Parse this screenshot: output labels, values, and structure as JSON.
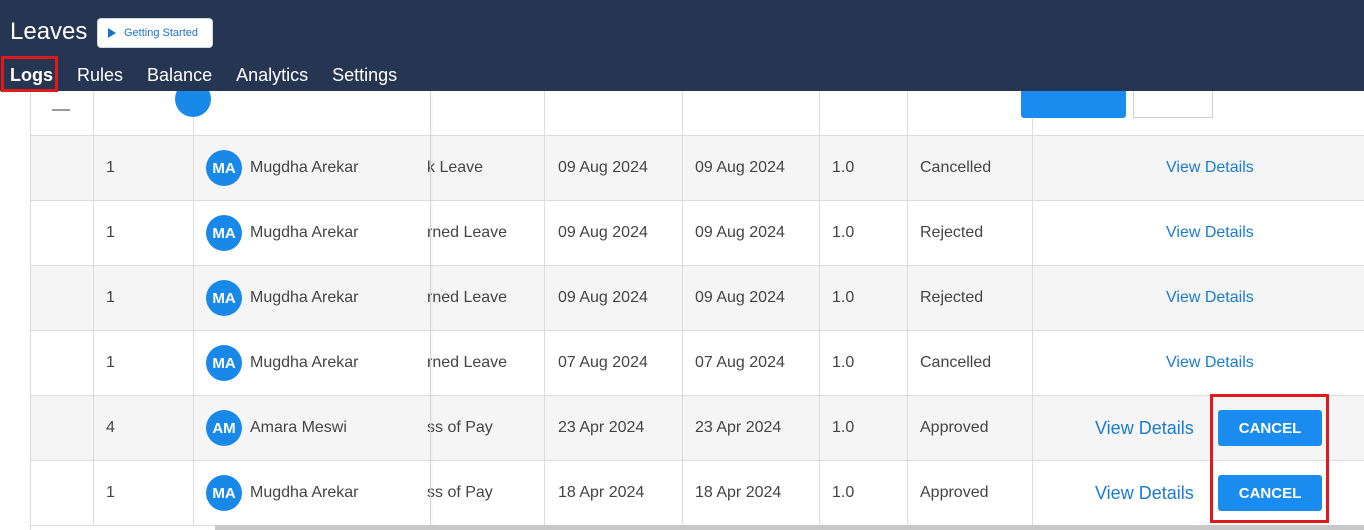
{
  "app": {
    "title": "Leaves",
    "getting_started_label": "Getting Started"
  },
  "tabs": [
    {
      "label": "Logs",
      "active": true
    },
    {
      "label": "Rules",
      "active": false
    },
    {
      "label": "Balance",
      "active": false
    },
    {
      "label": "Analytics",
      "active": false
    },
    {
      "label": "Settings",
      "active": false
    }
  ],
  "rows": [
    {
      "count": "1",
      "initials": "MA",
      "name": "Mugdha Arekar",
      "leave_type": "k Leave",
      "from": "09 Aug 2024",
      "to": "09 Aug 2024",
      "days": "1.0",
      "status": "Cancelled",
      "view": "View Details",
      "cancel": ""
    },
    {
      "count": "1",
      "initials": "MA",
      "name": "Mugdha Arekar",
      "leave_type": "rned Leave",
      "from": "09 Aug 2024",
      "to": "09 Aug 2024",
      "days": "1.0",
      "status": "Rejected",
      "view": "View Details",
      "cancel": ""
    },
    {
      "count": "1",
      "initials": "MA",
      "name": "Mugdha Arekar",
      "leave_type": "rned Leave",
      "from": "09 Aug 2024",
      "to": "09 Aug 2024",
      "days": "1.0",
      "status": "Rejected",
      "view": "View Details",
      "cancel": ""
    },
    {
      "count": "1",
      "initials": "MA",
      "name": "Mugdha Arekar",
      "leave_type": "rned Leave",
      "from": "07 Aug 2024",
      "to": "07 Aug 2024",
      "days": "1.0",
      "status": "Cancelled",
      "view": "View Details",
      "cancel": ""
    },
    {
      "count": "4",
      "initials": "AM",
      "name": "Amara Meswi",
      "leave_type": "ss of Pay",
      "from": "23 Apr 2024",
      "to": "23 Apr 2024",
      "days": "1.0",
      "status": "Approved",
      "view": "View Details",
      "cancel": "CANCEL"
    },
    {
      "count": "1",
      "initials": "MA",
      "name": "Mugdha Arekar",
      "leave_type": "ss of Pay",
      "from": "18 Apr 2024",
      "to": "18 Apr 2024",
      "days": "1.0",
      "status": "Approved",
      "view": "View Details",
      "cancel": "CANCEL"
    }
  ],
  "colors": {
    "header_bg": "#263551",
    "accent": "#1a8cf0",
    "highlight": "#e0191b",
    "link": "#1a7bd0"
  }
}
